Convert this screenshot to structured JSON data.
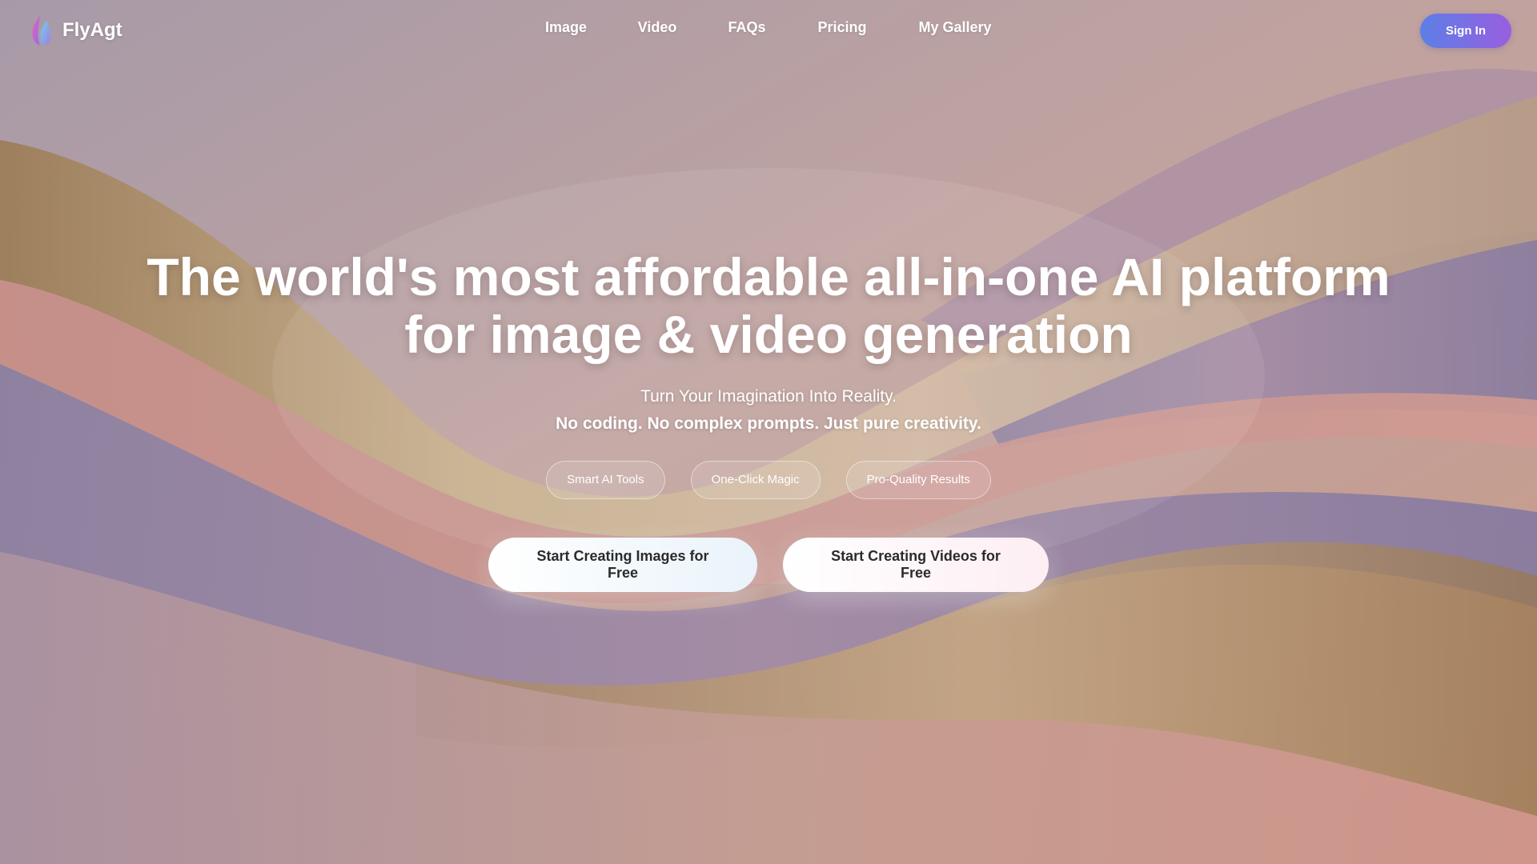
{
  "colors": {
    "brand_gradient_start": "#5b7fe6",
    "brand_gradient_end": "#9a5ee0",
    "text_on_hero": "#ffffff",
    "cta_text": "#2b2b2b"
  },
  "header": {
    "logo_icon": "flame-icon",
    "logo_text": "FlyAgt",
    "nav": [
      {
        "label": "Image"
      },
      {
        "label": "Video"
      },
      {
        "label": "FAQs"
      },
      {
        "label": "Pricing"
      },
      {
        "label": "My Gallery"
      }
    ],
    "signin_label": "Sign In"
  },
  "hero": {
    "title_line1": "The world's most affordable all-in-one AI platform",
    "title_line2": "for image & video generation",
    "subtitle": "Turn Your Imagination Into Reality.",
    "subtitle_strong": "No coding. No complex prompts. Just pure creativity.",
    "features": [
      "Smart AI Tools",
      "One-Click Magic",
      "Pro-Quality Results"
    ],
    "cta_images": "Start Creating Images for Free",
    "cta_videos": "Start Creating Videos for Free"
  }
}
